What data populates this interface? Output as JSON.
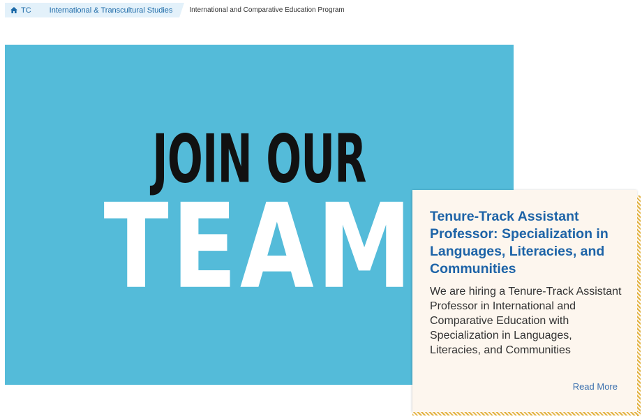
{
  "breadcrumb": {
    "home_label": "TC",
    "home_icon": "home-icon",
    "section_label": "International & Transcultural Studies",
    "current_label": "International and Comparative Education Program"
  },
  "hero": {
    "line1": "JOIN OUR",
    "line2": "TEAM",
    "background_color": "#54bbd9"
  },
  "card": {
    "title": "Tenure-Track Assistant Professor: Specialization in Languages, Literacies, and Communities",
    "description": "We are hiring a Tenure-Track Assistant Professor in International and Comparative Education with Specialization in Languages, Literacies, and Communities",
    "read_more": "Read More",
    "accent_color": "#1d63a7",
    "border_color": "#e2b342"
  }
}
